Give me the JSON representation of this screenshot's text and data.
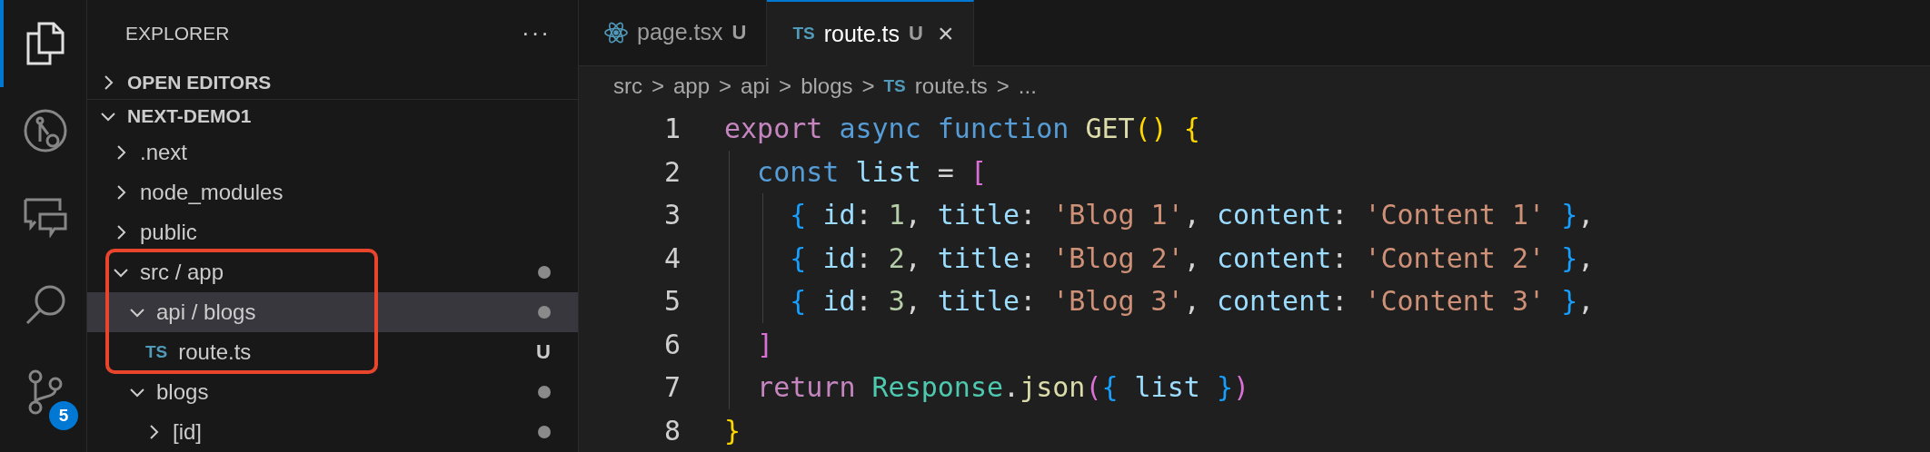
{
  "activity_bar": [
    {
      "kind": "files",
      "selected": true
    },
    {
      "kind": "debug",
      "selected": false
    },
    {
      "kind": "chat",
      "selected": false
    },
    {
      "kind": "search",
      "selected": false
    },
    {
      "kind": "branches",
      "selected": false,
      "badge": "5"
    }
  ],
  "sidebar": {
    "title": "EXPLORER",
    "more": "···",
    "sections": [
      {
        "label": "OPEN EDITORS",
        "expanded": false
      },
      {
        "label": "NEXT-DEMO1",
        "expanded": true
      }
    ],
    "tree": [
      {
        "name": ".next",
        "kind": "folder",
        "expanded": false
      },
      {
        "name": "node_modules",
        "kind": "folder",
        "expanded": false
      },
      {
        "name": "public",
        "kind": "folder",
        "expanded": false
      },
      {
        "name": "src / app",
        "kind": "folder",
        "expanded": true,
        "dot": true,
        "in_frame": true,
        "selected": false,
        "children": [
          {
            "name": "api / blogs",
            "kind": "folder",
            "expanded": true,
            "dot": true,
            "in_frame": true,
            "selected": true,
            "children": [
              {
                "name": "route.ts",
                "kind": "file",
                "file_icon": "TS",
                "status": "U",
                "in_frame": true,
                "selected": false
              }
            ]
          },
          {
            "name": "blogs",
            "kind": "folder",
            "expanded": true,
            "dot": true,
            "selected": false,
            "children": [
              {
                "name": "[id]",
                "kind": "folder",
                "expanded": false,
                "dot": true,
                "selected": false
              }
            ]
          }
        ]
      }
    ]
  },
  "tabs": [
    {
      "label": "page.tsx",
      "kind": "component",
      "status": "U",
      "selected": false
    },
    {
      "label": "route.ts",
      "kind": "script",
      "file_icon": "TS",
      "status": "U",
      "selected": true,
      "close": "×"
    }
  ],
  "breadcrumb": [
    {
      "label": "src"
    },
    {
      "label": "app"
    },
    {
      "label": "api"
    },
    {
      "label": "blogs"
    },
    {
      "label": "route.ts",
      "file_icon": "TS"
    },
    {
      "label": "..."
    }
  ],
  "breadcrumb_separator": ">",
  "code": [
    {
      "number": "1",
      "tokens": [
        {
          "kind": "keyword",
          "text": "export "
        },
        {
          "kind": "storage",
          "text": "async "
        },
        {
          "kind": "storage",
          "text": "function "
        },
        {
          "kind": "function",
          "text": "GET"
        },
        {
          "kind": "bracket1",
          "text": "() "
        },
        {
          "kind": "bracket1",
          "text": "{"
        }
      ]
    },
    {
      "number": "2",
      "tokens": [
        {
          "kind": "storage",
          "text": "  const "
        },
        {
          "kind": "variable",
          "text": "list"
        },
        {
          "kind": "plain",
          "text": " = "
        },
        {
          "kind": "bracket2",
          "text": "["
        }
      ]
    },
    {
      "number": "3",
      "tokens": [
        {
          "kind": "bracket3",
          "text": "    { "
        },
        {
          "kind": "variable",
          "text": "id"
        },
        {
          "kind": "plain",
          "text": ": "
        },
        {
          "kind": "number",
          "text": "1"
        },
        {
          "kind": "plain",
          "text": ", "
        },
        {
          "kind": "variable",
          "text": "title"
        },
        {
          "kind": "plain",
          "text": ": "
        },
        {
          "kind": "string",
          "text": "'Blog 1'"
        },
        {
          "kind": "plain",
          "text": ", "
        },
        {
          "kind": "variable",
          "text": "content"
        },
        {
          "kind": "plain",
          "text": ": "
        },
        {
          "kind": "string",
          "text": "'Content 1' "
        },
        {
          "kind": "bracket3",
          "text": "}"
        },
        {
          "kind": "plain",
          "text": ","
        }
      ]
    },
    {
      "number": "4",
      "tokens": [
        {
          "kind": "bracket3",
          "text": "    { "
        },
        {
          "kind": "variable",
          "text": "id"
        },
        {
          "kind": "plain",
          "text": ": "
        },
        {
          "kind": "number",
          "text": "2"
        },
        {
          "kind": "plain",
          "text": ", "
        },
        {
          "kind": "variable",
          "text": "title"
        },
        {
          "kind": "plain",
          "text": ": "
        },
        {
          "kind": "string",
          "text": "'Blog 2'"
        },
        {
          "kind": "plain",
          "text": ", "
        },
        {
          "kind": "variable",
          "text": "content"
        },
        {
          "kind": "plain",
          "text": ": "
        },
        {
          "kind": "string",
          "text": "'Content 2' "
        },
        {
          "kind": "bracket3",
          "text": "}"
        },
        {
          "kind": "plain",
          "text": ","
        }
      ]
    },
    {
      "number": "5",
      "tokens": [
        {
          "kind": "bracket3",
          "text": "    { "
        },
        {
          "kind": "variable",
          "text": "id"
        },
        {
          "kind": "plain",
          "text": ": "
        },
        {
          "kind": "number",
          "text": "3"
        },
        {
          "kind": "plain",
          "text": ", "
        },
        {
          "kind": "variable",
          "text": "title"
        },
        {
          "kind": "plain",
          "text": ": "
        },
        {
          "kind": "string",
          "text": "'Blog 3'"
        },
        {
          "kind": "plain",
          "text": ", "
        },
        {
          "kind": "variable",
          "text": "content"
        },
        {
          "kind": "plain",
          "text": ": "
        },
        {
          "kind": "string",
          "text": "'Content 3' "
        },
        {
          "kind": "bracket3",
          "text": "}"
        },
        {
          "kind": "plain",
          "text": ","
        }
      ]
    },
    {
      "number": "6",
      "tokens": [
        {
          "kind": "bracket2",
          "text": "  ]"
        }
      ]
    },
    {
      "number": "7",
      "tokens": [
        {
          "kind": "keyword",
          "text": "  return "
        },
        {
          "kind": "class",
          "text": "Response"
        },
        {
          "kind": "plain",
          "text": "."
        },
        {
          "kind": "function",
          "text": "json"
        },
        {
          "kind": "bracket2",
          "text": "("
        },
        {
          "kind": "bracket3",
          "text": "{ "
        },
        {
          "kind": "variable",
          "text": "list "
        },
        {
          "kind": "bracket3",
          "text": "}"
        },
        {
          "kind": "bracket2",
          "text": ")"
        }
      ]
    },
    {
      "number": "8",
      "tokens": [
        {
          "kind": "bracket1",
          "text": "}"
        }
      ]
    }
  ]
}
